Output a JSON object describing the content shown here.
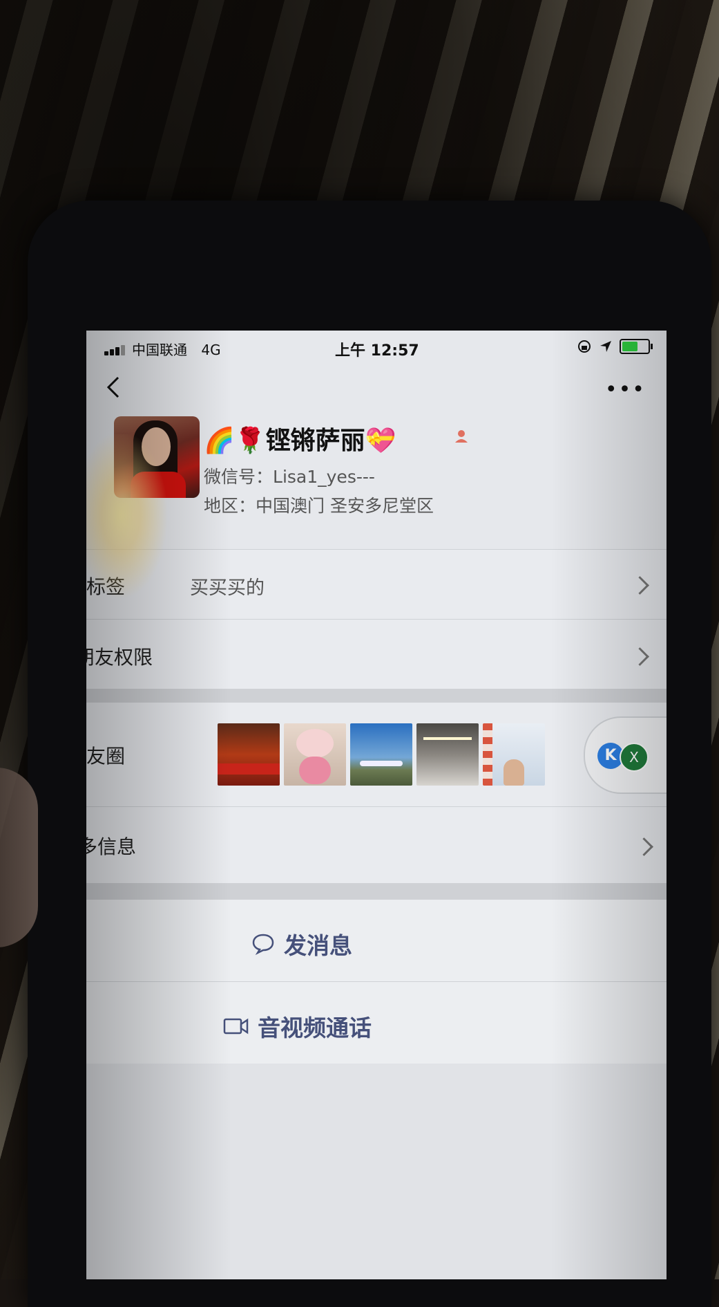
{
  "status_bar": {
    "carrier": "中国联通",
    "network": "4G",
    "time": "上午 12:57",
    "battery_level": 0.7
  },
  "nav": {
    "back_icon": "chevron-left-icon",
    "more_icon": "more-dots-icon",
    "more_label": "•••"
  },
  "profile": {
    "nickname_prefix": "🌈🌹",
    "nickname": "铿锵萨丽",
    "nickname_suffix": "💝",
    "wechat_id_label": "微信号：",
    "wechat_id": "Lisa1_yes---",
    "region_label": "地区：",
    "region": "中国澳门 圣安多尼堂区"
  },
  "rows": {
    "tags": {
      "label": "标签",
      "value": "买买买的"
    },
    "friend_permission": {
      "label": "朋友权限"
    },
    "moments": {
      "label": "朋友圈"
    },
    "more_info": {
      "label": "更多信息"
    }
  },
  "floating": {
    "k_label": "K",
    "x_label": "X"
  },
  "actions": {
    "message": {
      "label": "发消息",
      "icon": "chat-bubble-icon"
    },
    "call": {
      "label": "音视频通话",
      "icon": "video-camera-icon"
    }
  },
  "colors": {
    "action_text": "#45507a",
    "screen_bg": "#e6e8ec",
    "battery_fill": "#2ecc40"
  }
}
